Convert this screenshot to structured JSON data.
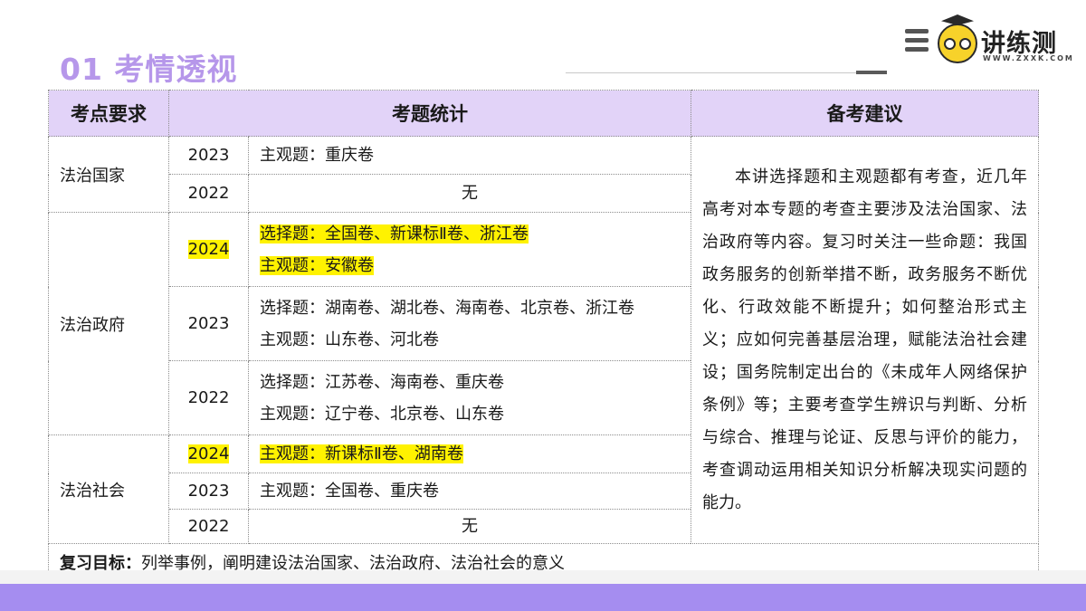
{
  "page": {
    "title": "01 考情透视"
  },
  "logo": {
    "brand": "讲练测",
    "url": "WWW.ZXXK.COM"
  },
  "table": {
    "headers": [
      "考点要求",
      "考题统计",
      "备考建议"
    ],
    "groups": [
      {
        "topic": "法治国家",
        "rows": [
          {
            "year": "2023",
            "year_highlight": false,
            "lines": [
              {
                "text": "主观题：重庆卷",
                "highlight": false
              }
            ]
          },
          {
            "year": "2022",
            "year_highlight": false,
            "lines": [
              {
                "text": "无",
                "highlight": false,
                "center": true
              }
            ]
          }
        ]
      },
      {
        "topic": "法治政府",
        "rows": [
          {
            "year": "2024",
            "year_highlight": true,
            "lines": [
              {
                "text": "选择题：全国卷、新课标Ⅱ卷、浙江卷",
                "highlight": true
              },
              {
                "text": "主观题：安徽卷",
                "highlight": true
              }
            ]
          },
          {
            "year": "2023",
            "year_highlight": false,
            "lines": [
              {
                "text": "选择题：湖南卷、湖北卷、海南卷、北京卷、浙江卷",
                "highlight": false
              },
              {
                "text": "主观题：山东卷、河北卷",
                "highlight": false
              }
            ]
          },
          {
            "year": "2022",
            "year_highlight": false,
            "lines": [
              {
                "text": "选择题：江苏卷、海南卷、重庆卷",
                "highlight": false
              },
              {
                "text": "主观题：辽宁卷、北京卷、山东卷",
                "highlight": false
              }
            ]
          }
        ]
      },
      {
        "topic": "法治社会",
        "rows": [
          {
            "year": "2024",
            "year_highlight": true,
            "lines": [
              {
                "text": "主观题：新课标Ⅱ卷、湖南卷",
                "highlight": true
              }
            ]
          },
          {
            "year": "2023",
            "year_highlight": false,
            "lines": [
              {
                "text": "主观题：全国卷、重庆卷",
                "highlight": false
              }
            ]
          },
          {
            "year": "2022",
            "year_highlight": false,
            "lines": [
              {
                "text": "无",
                "highlight": false,
                "center": true
              }
            ]
          }
        ]
      }
    ],
    "advice": "本讲选择题和主观题都有考查，近几年高考对本专题的考查主要涉及法治国家、法治政府等内容。复习时关注一些命题：我国政务服务的创新举措不断，政务服务不断优化、行政效能不断提升；如何整治形式主义；应如何完善基层治理，赋能法治社会建设；国务院制定出台的《未成年人网络保护条例》等；主要考查学生辨识与判断、分析与综合、推理与论证、反思与评价的能力，考查调动运用相关知识分析解决现实问题的能力。",
    "footer": {
      "label": "复习目标：",
      "text": "列举事例，阐明建设法治国家、法治政府、法治社会的意义"
    }
  },
  "colors": {
    "title": "#b697ea",
    "header_bg": "#e2d3f8",
    "highlight": "#fff200",
    "band": "#a58df0"
  }
}
